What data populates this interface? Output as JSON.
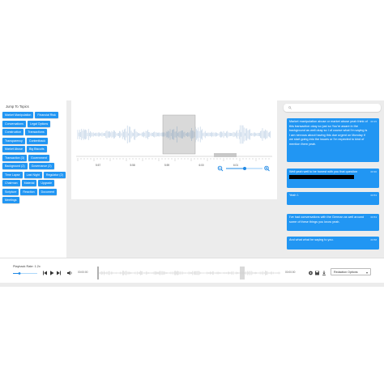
{
  "topics": {
    "title": "Jump To Topics",
    "items": [
      "Market Manipulation",
      "Financial Risk",
      "Conversations",
      "Legal Options",
      "Construction",
      "Transactions",
      "Transparency",
      "Contentback",
      "Market Abuse",
      "Big Biscuits",
      "Transaction (3)",
      "Government",
      "Background (2)",
      "Governance (2)",
      "Time Lapse",
      "Last Night",
      "Regulator (2)",
      "Chairman",
      "Material",
      "Upgrade",
      "Scripture",
      "Reaction",
      "Document",
      "Meetings"
    ]
  },
  "timeline": {
    "ticks": [
      "5:57",
      "5:58",
      "5:59",
      "6:00",
      "6:01"
    ]
  },
  "transcript": {
    "messages": [
      {
        "time": "00:15",
        "text": "Market manipulation abuse or market abuse yeah think of this transaction okay so just so You're aware in the background as well okay so I of course what I'm saying is I am nervous about having this due urgent on Monday if we start going into the issues or I'm expected to kind of mention them yeah.",
        "redacted": false
      },
      {
        "time": "00:30",
        "text": "Well yeah well to be honest with you that question",
        "redacted": true
      },
      {
        "time": "00:53",
        "text": "Yeah I.",
        "redacted": false
      },
      {
        "time": "00:53",
        "text": "I've had conversations with the German as well around some of these things you know yeah.",
        "redacted": false
      },
      {
        "time": "00:58",
        "text": "And what what he saying to you.",
        "redacted": false
      }
    ]
  },
  "player": {
    "rate_label": "Playback Rate: 1.2x",
    "time_current": "00:00:00",
    "time_total": "00:00:00",
    "redaction_option": "Redaction Options"
  },
  "colors": {
    "accent": "#2196f3",
    "wave": "#b9cde3",
    "selection": "#d3d3d3"
  }
}
